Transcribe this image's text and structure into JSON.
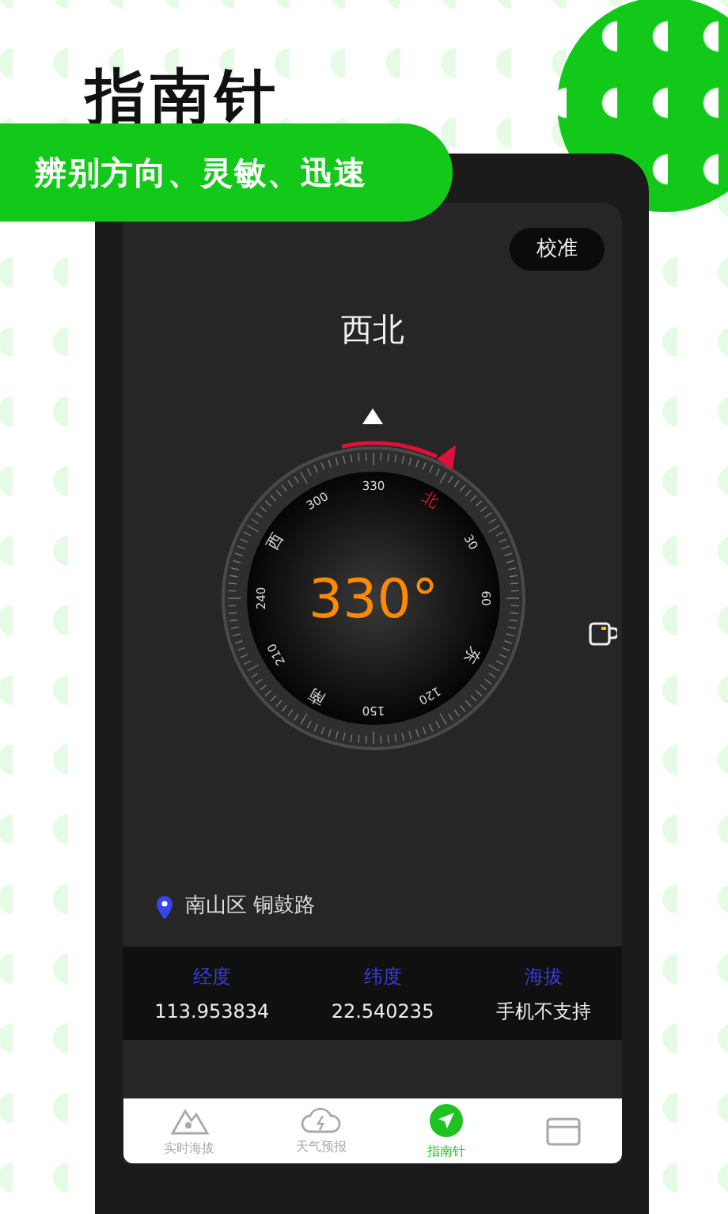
{
  "header": {
    "title": "指南针",
    "tagline": "辨别方向、灵敏、迅速"
  },
  "screen": {
    "calibrate_button": "校准",
    "direction": "西北",
    "compass": {
      "reading": "330°",
      "dial_labels": [
        {
          "text": "330",
          "highlighted": false
        },
        {
          "text": "北",
          "highlighted": true
        },
        {
          "text": "30",
          "highlighted": false
        },
        {
          "text": "60",
          "highlighted": false
        },
        {
          "text": "东",
          "highlighted": false
        },
        {
          "text": "120",
          "highlighted": false
        },
        {
          "text": "150",
          "highlighted": false
        },
        {
          "text": "南",
          "highlighted": false
        },
        {
          "text": "210",
          "highlighted": false
        },
        {
          "text": "240",
          "highlighted": false
        },
        {
          "text": "西",
          "highlighted": false
        },
        {
          "text": "300",
          "highlighted": false
        }
      ]
    },
    "location": "南山区 铜鼓路",
    "info": [
      {
        "label": "经度",
        "value": "113.953834"
      },
      {
        "label": "纬度",
        "value": "22.540235"
      },
      {
        "label": "海拔",
        "value": "手机不支持"
      }
    ],
    "tabs": [
      {
        "kind": "mountain",
        "label": "实时海拔",
        "selected": false
      },
      {
        "kind": "cloud",
        "label": "天气预报",
        "selected": false
      },
      {
        "kind": "compass",
        "label": "指南针",
        "selected": true
      },
      {
        "kind": "tablet",
        "selected": false
      }
    ]
  }
}
